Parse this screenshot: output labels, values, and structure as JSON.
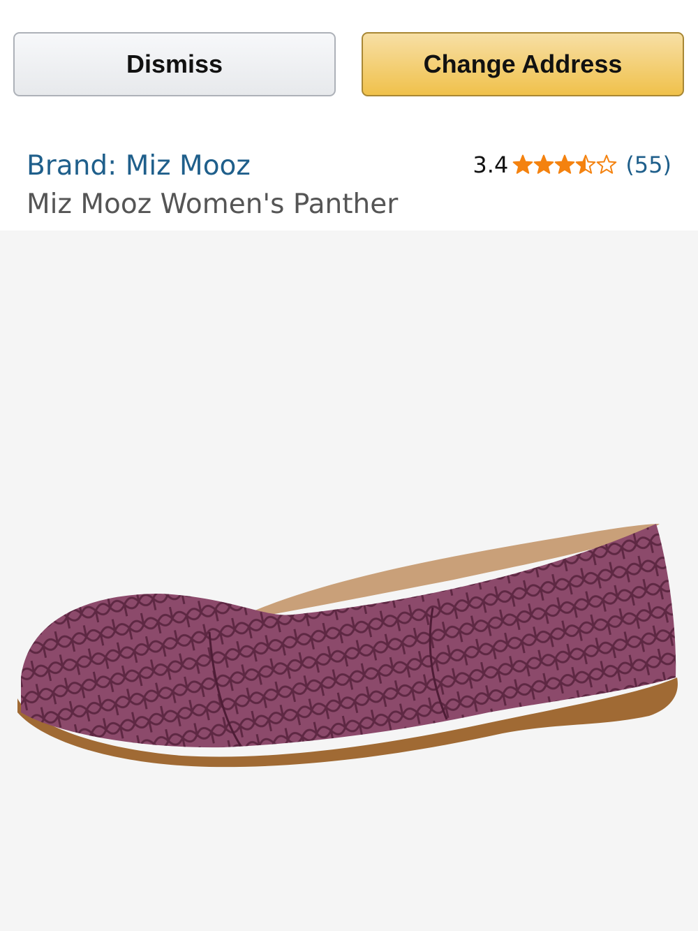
{
  "actions": {
    "dismiss_label": "Dismiss",
    "change_address_label": "Change Address"
  },
  "product": {
    "brand": "Brand: Miz Mooz",
    "title": "Miz Mooz Women's Panther",
    "rating": {
      "value_text": "3.4",
      "value": 3.4,
      "max": 5,
      "count_text": "(55)",
      "star_color": "#f4820f"
    },
    "image": {
      "icon": "shoe-image",
      "upper_color": "#8c4a6b",
      "pattern_color": "#4e1d36",
      "sole_color": "#a06a34",
      "lining_color": "#c9a079"
    }
  },
  "colors": {
    "link": "#1f5f8b",
    "secondary_text": "#555555",
    "image_background": "#f5f5f5"
  }
}
